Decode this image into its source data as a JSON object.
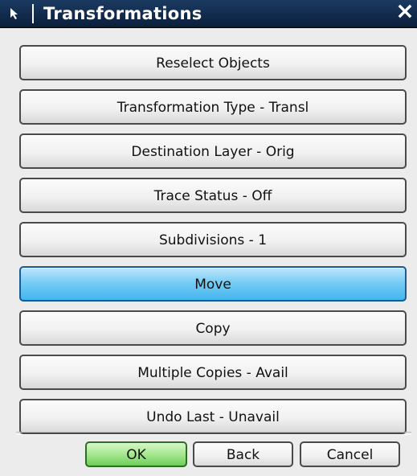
{
  "window": {
    "title": "Transformations",
    "title_icon": "arrow-pointer-icon",
    "close_icon": "close-icon"
  },
  "actions": [
    {
      "label": "Reselect Objects",
      "active": false
    },
    {
      "label": "Transformation Type - Transl",
      "active": false
    },
    {
      "label": "Destination Layer - Orig",
      "active": false
    },
    {
      "label": "Trace Status - Off",
      "active": false
    },
    {
      "label": "Subdivisions - 1",
      "active": false
    },
    {
      "label": "Move",
      "active": true
    },
    {
      "label": "Copy",
      "active": false
    },
    {
      "label": "Multiple Copies - Avail",
      "active": false
    },
    {
      "label": "Undo Last - Unavail",
      "active": false
    }
  ],
  "footer": {
    "ok_label": "OK",
    "back_label": "Back",
    "cancel_label": "Cancel"
  },
  "colors": {
    "titlebar": "#0f2a4d",
    "active_button": "#5cc1f2",
    "ok_button": "#8fdd78"
  }
}
